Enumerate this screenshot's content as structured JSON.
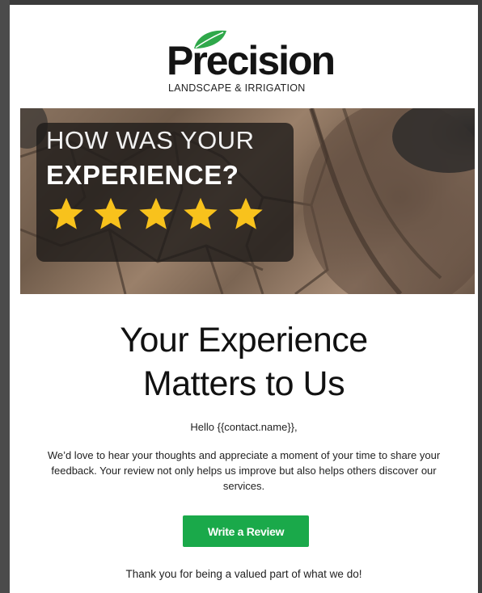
{
  "brand": {
    "name": "Precision",
    "tagline": "LANDSCAPE & IRRIGATION",
    "accent_color": "#1aa94a",
    "leaf_color": "#2fa84a"
  },
  "hero": {
    "line1": "HOW WAS YOUR",
    "line2": "EXPERIENCE?",
    "stars": 5,
    "star_color": "#f8c21c"
  },
  "content": {
    "headline_line1": "Your Experience",
    "headline_line2": "Matters to Us",
    "greeting": "Hello {{contact.name}},",
    "paragraph": "We’d love to hear your thoughts and appreciate a moment of your time to share your feedback. Your review not only helps us improve but also helps others discover our services.",
    "cta_label": "Write a Review",
    "closing": "Thank you for being a valued part of what we do!"
  }
}
